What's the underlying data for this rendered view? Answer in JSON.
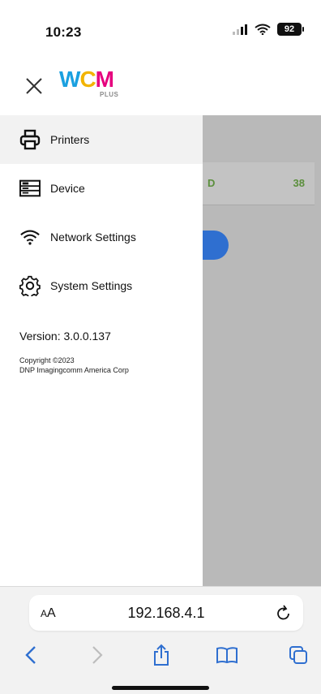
{
  "status_bar": {
    "time": "10:23",
    "battery": "92"
  },
  "header": {
    "logo": {
      "w": "W",
      "c": "C",
      "m": "M",
      "plus": "PLUS"
    }
  },
  "background": {
    "card_left": "D",
    "card_right": "38"
  },
  "menu": {
    "items": [
      {
        "label": "Printers",
        "icon": "printer-icon"
      },
      {
        "label": "Device",
        "icon": "device-icon"
      },
      {
        "label": "Network Settings",
        "icon": "wifi-icon"
      },
      {
        "label": "System Settings",
        "icon": "gear-icon"
      }
    ],
    "version": "Version: 3.0.0.137",
    "copyright_line1": "Copyright ©2023",
    "copyright_line2": "DNP Imagingcomm America Corp"
  },
  "browser": {
    "aa_small": "A",
    "aa_large": "A",
    "url": "192.168.4.1"
  },
  "colors": {
    "accent_blue": "#2f6fd0",
    "green_text": "#5b8f3c",
    "logo_w": "#1aa0e0",
    "logo_c": "#f2b400",
    "logo_m": "#e6007e"
  }
}
